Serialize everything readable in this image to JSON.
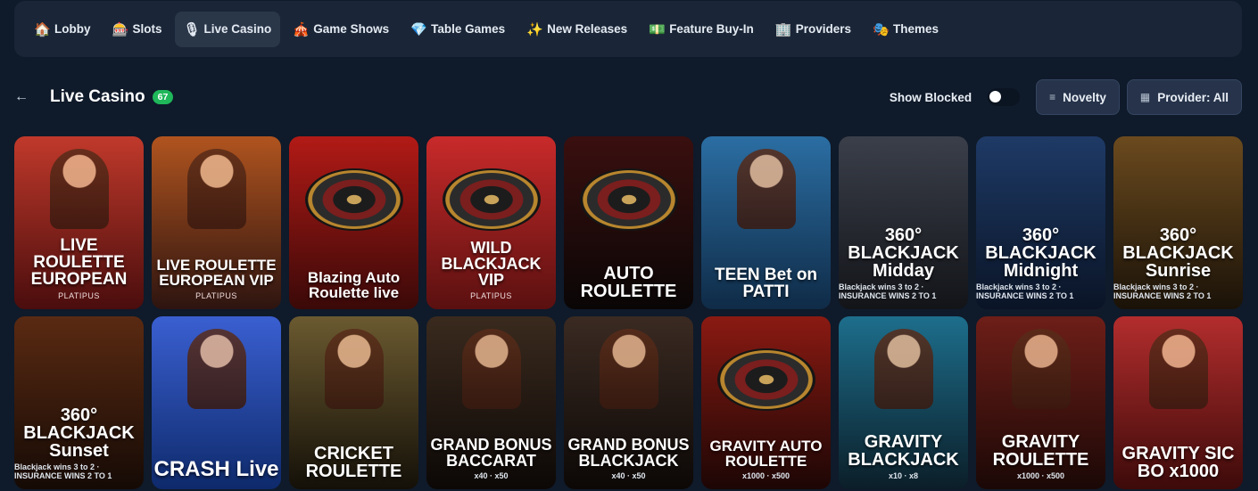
{
  "nav": {
    "tabs": [
      {
        "label": "Lobby",
        "icon": "🏠",
        "active": false
      },
      {
        "label": "Slots",
        "icon": "🎰",
        "active": false
      },
      {
        "label": "Live Casino",
        "icon": "🎙",
        "active": true
      },
      {
        "label": "Game Shows",
        "icon": "🎪",
        "active": false
      },
      {
        "label": "Table Games",
        "icon": "💎",
        "active": false
      },
      {
        "label": "New Releases",
        "icon": "✨",
        "active": false
      },
      {
        "label": "Feature Buy-In",
        "icon": "💵",
        "active": false
      },
      {
        "label": "Providers",
        "icon": "🏢",
        "active": false
      },
      {
        "label": "Themes",
        "icon": "🎭",
        "active": false
      }
    ]
  },
  "header": {
    "back_icon": "←",
    "title": "Live Casino",
    "count": "67",
    "show_blocked_label": "Show Blocked",
    "show_blocked_on": false,
    "sort_icon": "≡",
    "sort_label": "Novelty",
    "provider_icon": "▦",
    "provider_label": "Provider: All"
  },
  "games": [
    {
      "title": "LIVE ROULETTE EUROPEAN",
      "provider": "PLATIPUS",
      "extra": "",
      "art": "figure",
      "c1": "#c0392b",
      "c2": "#4a0d0d",
      "size": 19
    },
    {
      "title": "LIVE ROULETTE EUROPEAN VIP",
      "provider": "PLATIPUS",
      "extra": "",
      "art": "figure",
      "c1": "#b0541f",
      "c2": "#2d1410",
      "size": 17
    },
    {
      "title": "Blazing Auto Roulette live",
      "provider": "",
      "extra": "",
      "art": "wheel",
      "c1": "#b21a16",
      "c2": "#3a0908",
      "size": 17
    },
    {
      "title": "WILD BLACKJACK VIP",
      "provider": "PLATIPUS",
      "extra": "",
      "art": "cards",
      "c1": "#c92a2a",
      "c2": "#5a1010",
      "size": 18
    },
    {
      "title": "AUTO ROULETTE",
      "provider": "",
      "extra": "",
      "art": "wheel",
      "c1": "#3a0f0f",
      "c2": "#0a0606",
      "size": 20
    },
    {
      "title": "TEEN Bet on PATTI",
      "provider": "",
      "extra": "",
      "art": "figure",
      "c1": "#2b6ea3",
      "c2": "#0f2b47",
      "size": 19
    },
    {
      "title": "360° BLACKJACK Midday",
      "provider": "",
      "extra": "Blackjack wins 3 to 2 · INSURANCE WINS 2 TO 1",
      "art": "none",
      "c1": "#3b3f4a",
      "c2": "#121418",
      "size": 20
    },
    {
      "title": "360° BLACKJACK Midnight",
      "provider": "",
      "extra": "Blackjack wins 3 to 2 · INSURANCE WINS 2 TO 1",
      "art": "none",
      "c1": "#1e3a66",
      "c2": "#0a1426",
      "size": 20
    },
    {
      "title": "360° BLACKJACK Sunrise",
      "provider": "",
      "extra": "Blackjack wins 3 to 2 · INSURANCE WINS 2 TO 1",
      "art": "none",
      "c1": "#6b4a1e",
      "c2": "#1a1208",
      "size": 20
    },
    {
      "title": "360° BLACKJACK Sunset",
      "provider": "",
      "extra": "Blackjack wins 3 to 2 · INSURANCE WINS 2 TO 1",
      "art": "none",
      "c1": "#5a2a12",
      "c2": "#150a05",
      "size": 20
    },
    {
      "title": "CRASH Live",
      "provider": "",
      "extra": "",
      "art": "figure",
      "c1": "#3a5fd1",
      "c2": "#0e2a6b",
      "size": 24
    },
    {
      "title": "CRICKET ROULETTE",
      "provider": "",
      "extra": "",
      "art": "figure",
      "c1": "#6b5a30",
      "c2": "#141008",
      "size": 20
    },
    {
      "title": "GRAND BONUS BACCARAT",
      "provider": "",
      "extra": "x40 · x50",
      "art": "figure",
      "c1": "#3a2a1e",
      "c2": "#0c0806",
      "size": 18
    },
    {
      "title": "GRAND BONUS BLACKJACK",
      "provider": "",
      "extra": "x40 · x50",
      "art": "figure",
      "c1": "#3a2a22",
      "c2": "#0c0806",
      "size": 18
    },
    {
      "title": "GRAVITY AUTO ROULETTE",
      "provider": "",
      "extra": "x1000 · x500",
      "art": "wheel",
      "c1": "#8a1a12",
      "c2": "#1c0605",
      "size": 17
    },
    {
      "title": "GRAVITY BLACKJACK",
      "provider": "",
      "extra": "x10 · x8",
      "art": "figure",
      "c1": "#1d6e8c",
      "c2": "#0b1e28",
      "size": 20
    },
    {
      "title": "GRAVITY ROULETTE",
      "provider": "",
      "extra": "x1000 · x500",
      "art": "figure",
      "c1": "#6e1e18",
      "c2": "#1a0806",
      "size": 20
    },
    {
      "title": "GRAVITY SIC BO x1000",
      "provider": "",
      "extra": "",
      "art": "figure",
      "c1": "#b32d2d",
      "c2": "#3d0a0a",
      "size": 20
    }
  ]
}
